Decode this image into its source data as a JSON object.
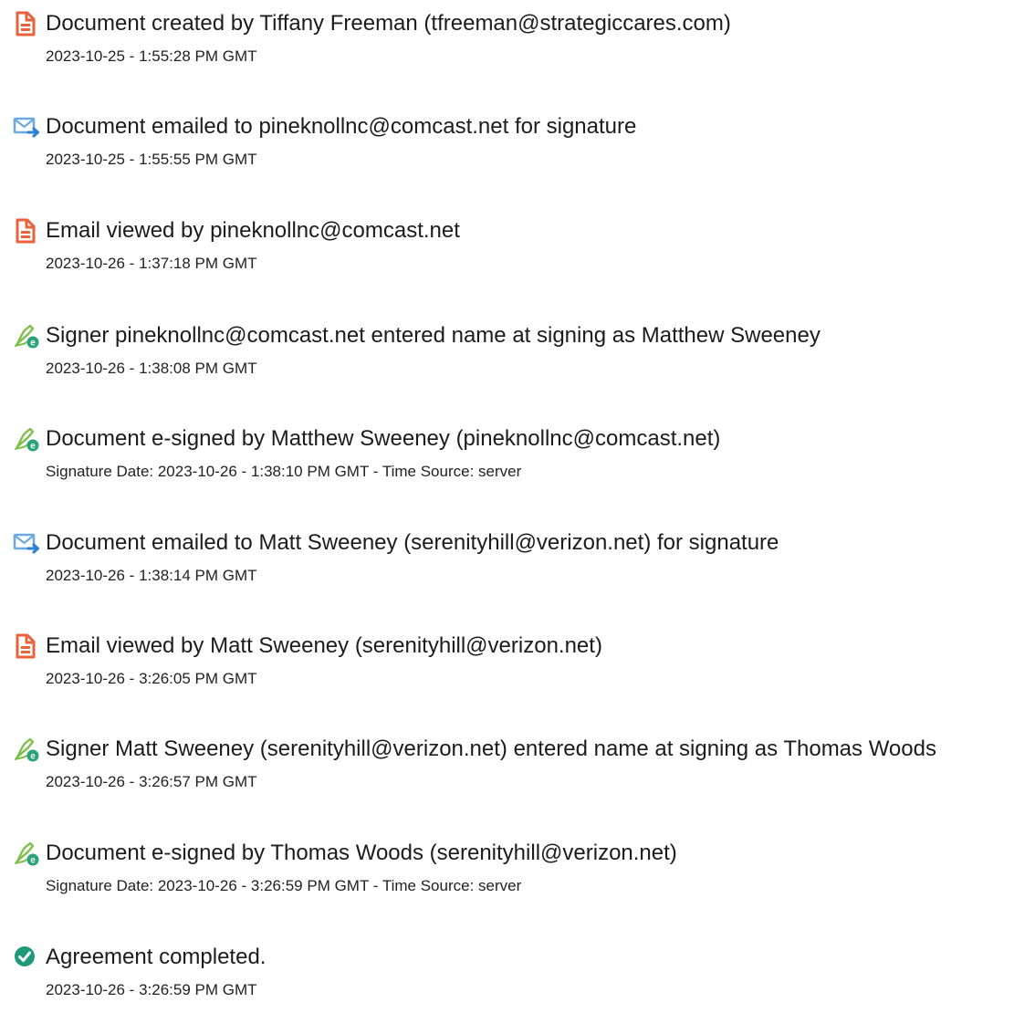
{
  "events": [
    {
      "icon": "document-icon",
      "title": "Document created by Tiffany Freeman (tfreeman@strategiccares.com)",
      "detail": "2023-10-25 - 1:55:28 PM GMT"
    },
    {
      "icon": "email-send-icon",
      "title": "Document emailed to pineknollnc@comcast.net for signature",
      "detail": "2023-10-25 - 1:55:55 PM GMT"
    },
    {
      "icon": "document-icon",
      "title": "Email viewed by pineknollnc@comcast.net",
      "detail": "2023-10-26 - 1:37:18 PM GMT"
    },
    {
      "icon": "signature-pen-icon",
      "title": "Signer pineknollnc@comcast.net entered name at signing as Matthew Sweeney",
      "detail": "2023-10-26 - 1:38:08 PM GMT"
    },
    {
      "icon": "signature-pen-icon",
      "title": "Document e-signed by Matthew Sweeney (pineknollnc@comcast.net)",
      "detail": "Signature Date: 2023-10-26 - 1:38:10 PM GMT - Time Source: server"
    },
    {
      "icon": "email-send-icon",
      "title": "Document emailed to Matt Sweeney (serenityhill@verizon.net) for signature",
      "detail": "2023-10-26 - 1:38:14 PM GMT"
    },
    {
      "icon": "document-icon",
      "title": "Email viewed by Matt Sweeney (serenityhill@verizon.net)",
      "detail": "2023-10-26 - 3:26:05 PM GMT"
    },
    {
      "icon": "signature-pen-icon",
      "title": "Signer Matt Sweeney (serenityhill@verizon.net) entered name at signing as Thomas Woods",
      "detail": "2023-10-26 - 3:26:57 PM GMT"
    },
    {
      "icon": "signature-pen-icon",
      "title": "Document e-signed by Thomas Woods (serenityhill@verizon.net)",
      "detail": "Signature Date: 2023-10-26 - 3:26:59 PM GMT - Time Source: server"
    },
    {
      "icon": "check-circle-icon",
      "title": "Agreement completed.",
      "detail": "2023-10-26 - 3:26:59 PM GMT"
    }
  ],
  "colors": {
    "document_icon": "#e8623a",
    "email_icon": "#6aa9e0",
    "email_arrow": "#2f7fd0",
    "signature_icon": "#7fbf4a",
    "signature_badge": "#2aa37a",
    "check_icon": "#1e9a7a"
  }
}
